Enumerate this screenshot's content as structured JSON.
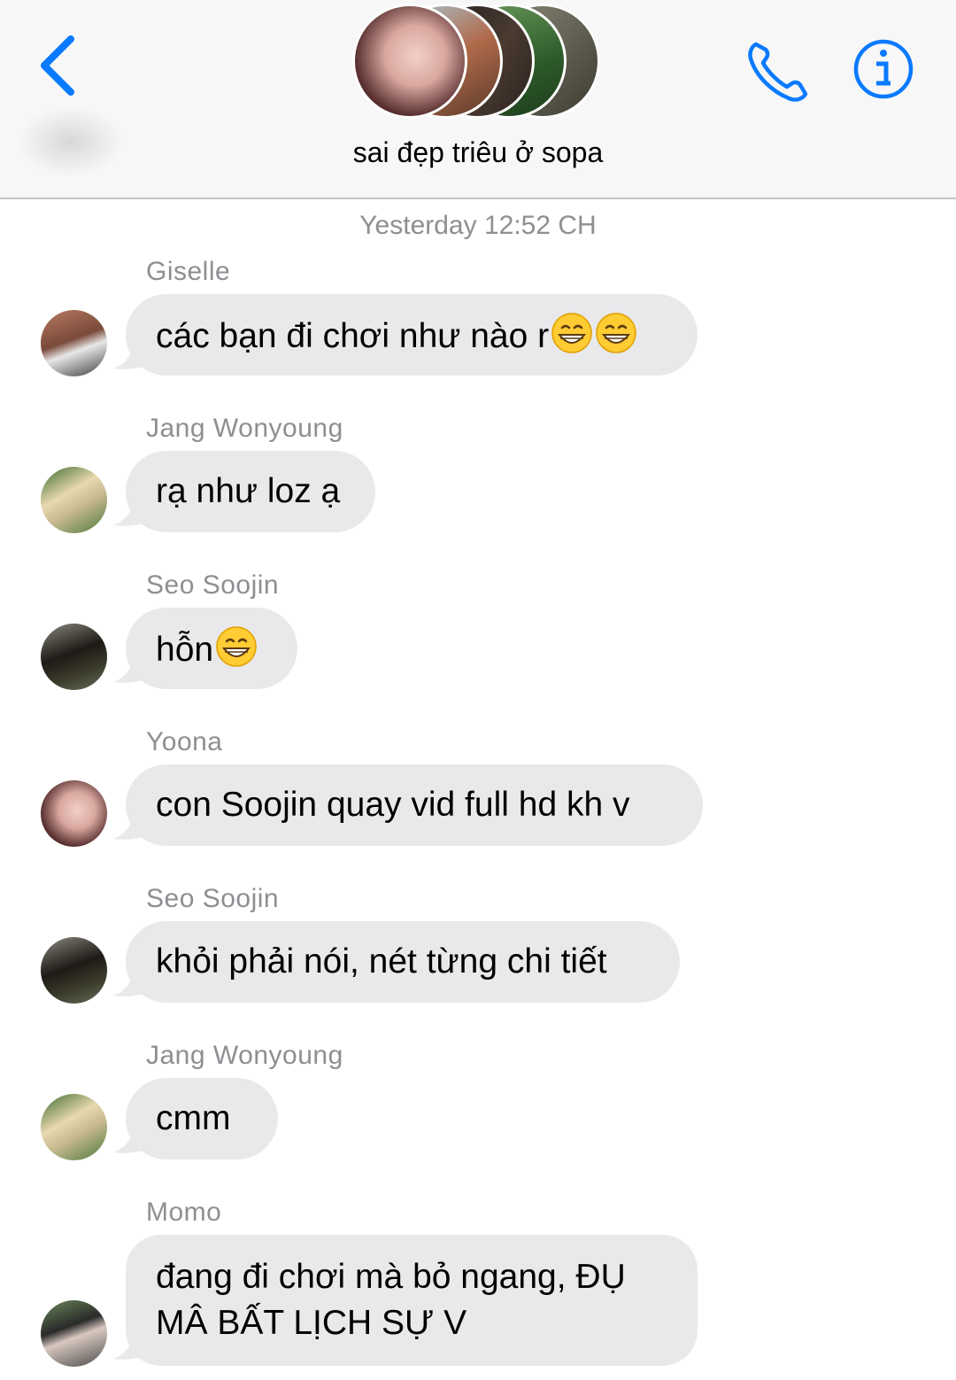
{
  "header": {
    "group_name": "sai đẹp triêu ở sopa",
    "back_label": "Back",
    "call_label": "Call",
    "info_label": "Info"
  },
  "timestamp": "Yesterday 12:52 CH",
  "messages": [
    {
      "sender": "Giselle",
      "text": "các bạn đi chơi như nào r",
      "emoji": [
        "grinning-face",
        "grinning-face"
      ],
      "avatar": "avatar-giselle"
    },
    {
      "sender": "Jang Wonyoung",
      "text": "rạ như loz ạ",
      "emoji": [],
      "avatar": "avatar-wonyoung"
    },
    {
      "sender": "Seo Soojin",
      "text": "hỗn",
      "emoji": [
        "grinning-face"
      ],
      "avatar": "avatar-soojin"
    },
    {
      "sender": "Yoona",
      "text": "con Soojin quay vid full hd kh v",
      "emoji": [],
      "avatar": "avatar-yoona"
    },
    {
      "sender": "Seo Soojin",
      "text": "khỏi phải nói, nét từng chi tiết",
      "emoji": [],
      "avatar": "avatar-soojin"
    },
    {
      "sender": "Jang Wonyoung",
      "text": "cmm",
      "emoji": [],
      "avatar": "avatar-wonyoung"
    },
    {
      "sender": "Momo",
      "text": "đang đi chơi mà bỏ ngang, ĐỤ MÂ BẤT LỊCH SỰ V",
      "emoji": [],
      "avatar": "avatar-momo"
    }
  ],
  "colors": {
    "accent": "#0a7aff",
    "bubble": "#e9e9eb",
    "meta_text": "#8e8e93",
    "header_bg": "#f7f7f7"
  }
}
